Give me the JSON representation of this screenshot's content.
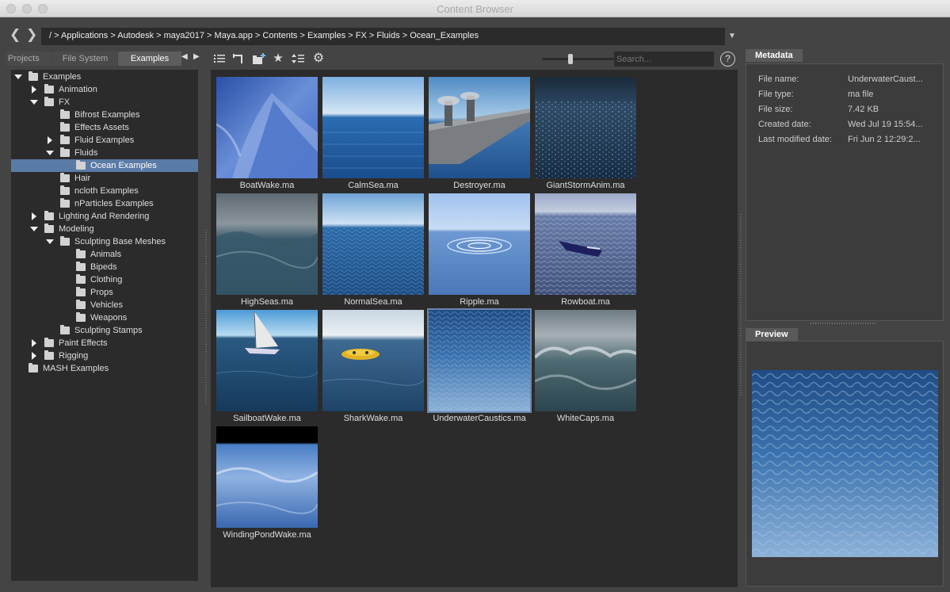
{
  "window": {
    "title": "Content Browser"
  },
  "path": {
    "text": "/  > Applications > Autodesk > maya2017 > Maya.app > Contents > Examples > FX > Fluids > Ocean_Examples"
  },
  "tabs": [
    {
      "label": "Projects"
    },
    {
      "label": "File System"
    },
    {
      "label": "Examples"
    }
  ],
  "tree": [
    {
      "label": "Examples",
      "level": 0,
      "toggle": "down"
    },
    {
      "label": "Animation",
      "level": 1,
      "toggle": "right"
    },
    {
      "label": "FX",
      "level": 1,
      "toggle": "down"
    },
    {
      "label": "Bifrost Examples",
      "level": 2,
      "toggle": "none"
    },
    {
      "label": "Effects Assets",
      "level": 2,
      "toggle": "none"
    },
    {
      "label": "Fluid Examples",
      "level": 2,
      "toggle": "right"
    },
    {
      "label": "Fluids",
      "level": 2,
      "toggle": "down"
    },
    {
      "label": "Ocean Examples",
      "level": 3,
      "toggle": "none",
      "selected": true
    },
    {
      "label": "Hair",
      "level": 2,
      "toggle": "none"
    },
    {
      "label": "ncloth Examples",
      "level": 2,
      "toggle": "none"
    },
    {
      "label": "nParticles Examples",
      "level": 2,
      "toggle": "none"
    },
    {
      "label": "Lighting And Rendering",
      "level": 1,
      "toggle": "right"
    },
    {
      "label": "Modeling",
      "level": 1,
      "toggle": "down"
    },
    {
      "label": "Sculpting Base Meshes",
      "level": 2,
      "toggle": "down"
    },
    {
      "label": "Animals",
      "level": 3,
      "toggle": "none"
    },
    {
      "label": "Bipeds",
      "level": 3,
      "toggle": "none"
    },
    {
      "label": "Clothing",
      "level": 3,
      "toggle": "none"
    },
    {
      "label": "Props",
      "level": 3,
      "toggle": "none"
    },
    {
      "label": "Vehicles",
      "level": 3,
      "toggle": "none"
    },
    {
      "label": "Weapons",
      "level": 3,
      "toggle": "none"
    },
    {
      "label": "Sculpting Stamps",
      "level": 2,
      "toggle": "none"
    },
    {
      "label": "Paint Effects",
      "level": 1,
      "toggle": "right"
    },
    {
      "label": "Rigging",
      "level": 1,
      "toggle": "right"
    },
    {
      "label": "MASH Examples",
      "level": 0,
      "toggle": "none"
    }
  ],
  "toolbar": {
    "icons": [
      "list-view-icon",
      "parent-folder-icon",
      "new-folder-icon",
      "favorite-star-icon",
      "sort-icon",
      "settings-gear-icon"
    ],
    "thumbnail_size": 0.35
  },
  "search": {
    "placeholder": "Search..."
  },
  "files": [
    {
      "name": "BoatWake.ma",
      "style": "boatwake"
    },
    {
      "name": "CalmSea.ma",
      "style": "calmsea"
    },
    {
      "name": "Destroyer.ma",
      "style": "destroyer"
    },
    {
      "name": "GiantStormAnim.ma",
      "style": "storm"
    },
    {
      "name": "HighSeas.ma",
      "style": "highseas"
    },
    {
      "name": "NormalSea.ma",
      "style": "normalsea"
    },
    {
      "name": "Ripple.ma",
      "style": "ripple"
    },
    {
      "name": "Rowboat.ma",
      "style": "rowboat"
    },
    {
      "name": "SailboatWake.ma",
      "style": "sailboat"
    },
    {
      "name": "SharkWake.ma",
      "style": "shark"
    },
    {
      "name": "UnderwaterCaustics.ma",
      "style": "caustics",
      "selected": true
    },
    {
      "name": "WhiteCaps.ma",
      "style": "whitecaps"
    },
    {
      "name": "WindingPondWake.ma",
      "style": "pond"
    }
  ],
  "metadata": {
    "tab_label": "Metadata",
    "rows": [
      {
        "key": "File name:",
        "value": "UnderwaterCaust..."
      },
      {
        "key": "File type:",
        "value": "ma file"
      },
      {
        "key": "File size:",
        "value": "7.42 KB"
      },
      {
        "key": "Created date:",
        "value": "Wed Jul 19 15:54..."
      },
      {
        "key": "Last modified date:",
        "value": "Fri Jun 2 12:29:2..."
      }
    ]
  },
  "preview": {
    "tab_label": "Preview"
  }
}
